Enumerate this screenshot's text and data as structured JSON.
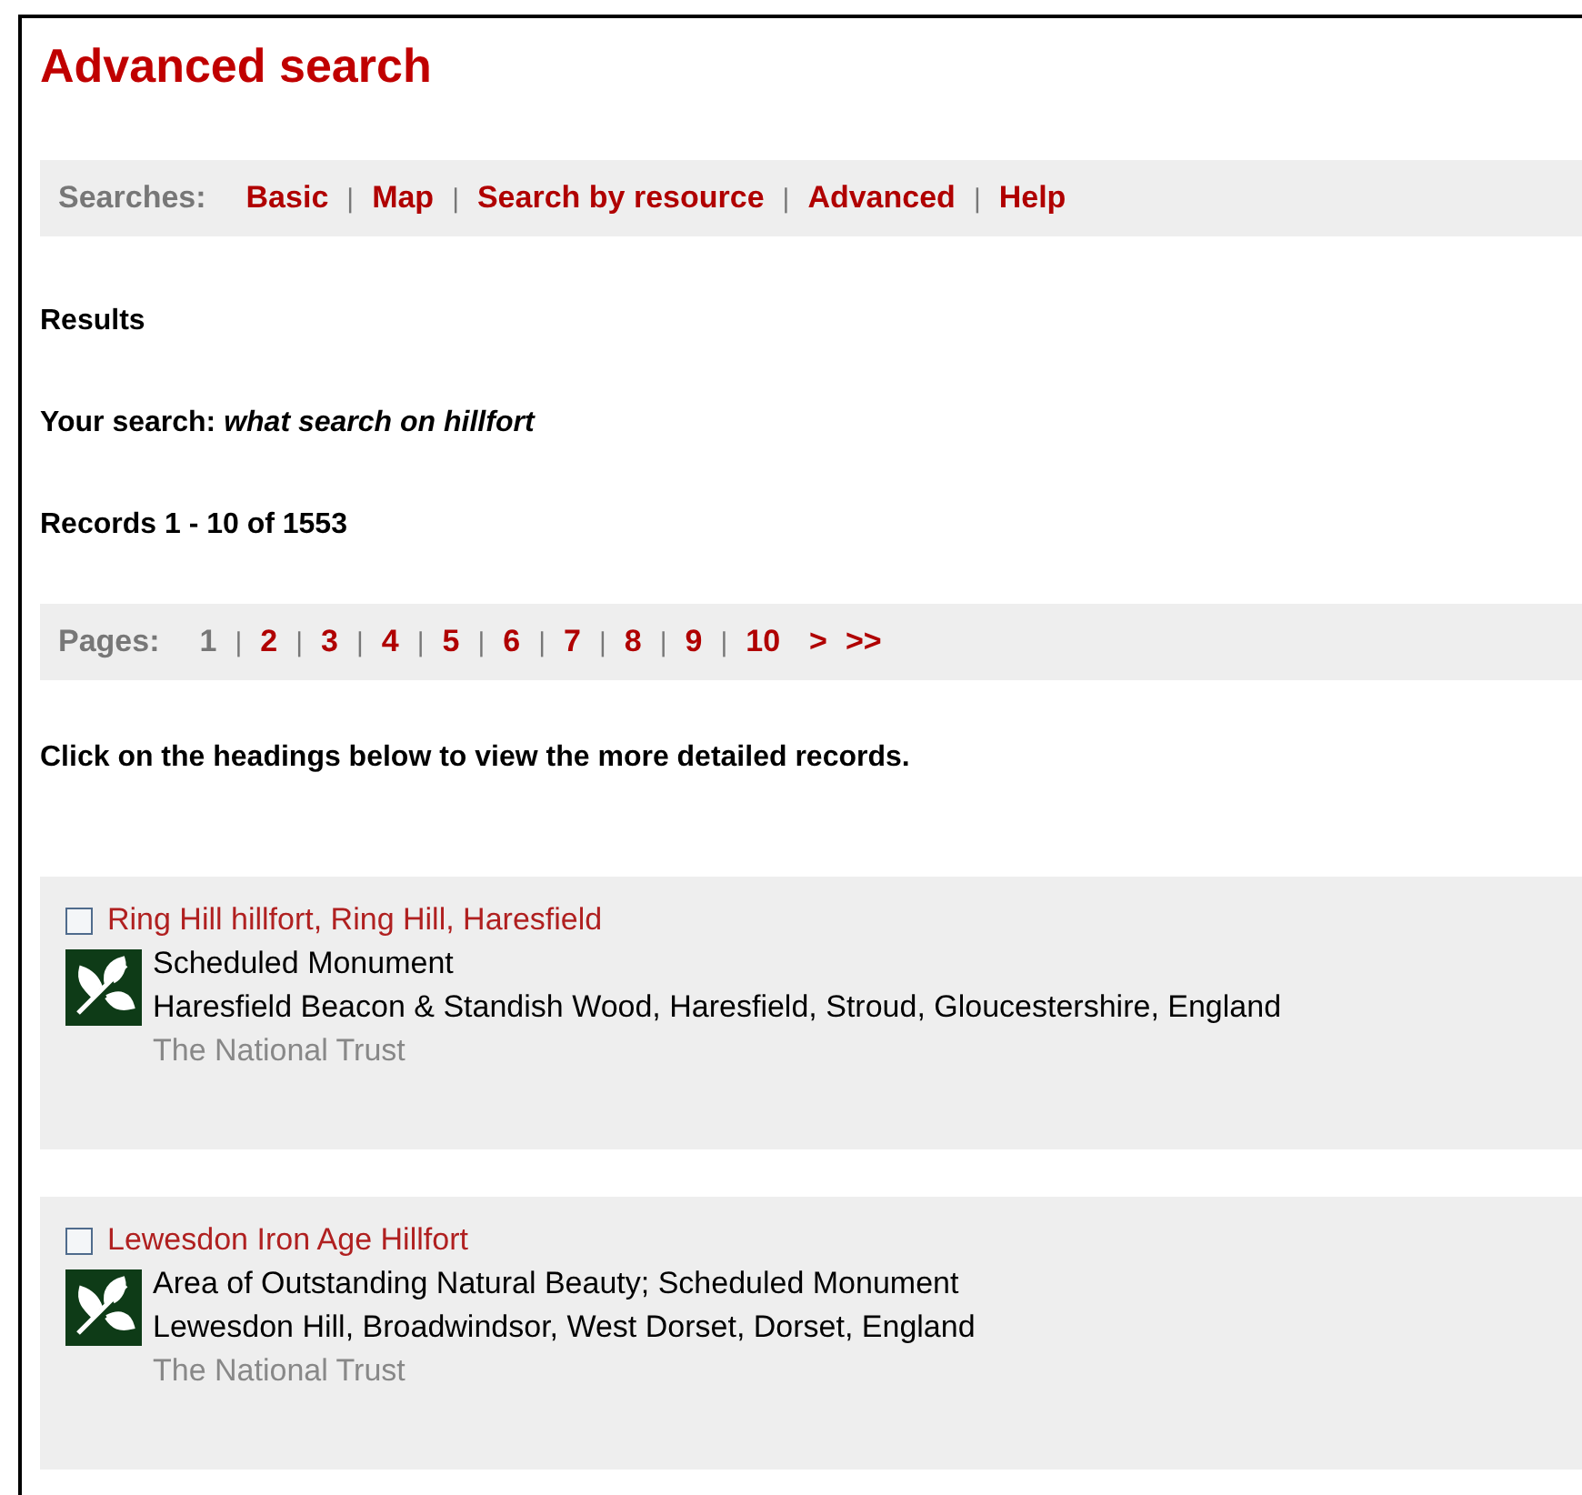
{
  "title": "Advanced search",
  "searches": {
    "label": "Searches:",
    "separator": "|",
    "links": [
      {
        "label": "Basic"
      },
      {
        "label": "Map"
      },
      {
        "label": "Search by resource"
      },
      {
        "label": "Advanced"
      },
      {
        "label": "Help"
      }
    ]
  },
  "results_heading": "Results",
  "your_search": {
    "label": "Your search:",
    "query": "what search on hillfort"
  },
  "records_count": "Records 1 - 10 of 1553",
  "pages": {
    "label": "Pages:",
    "separator": "|",
    "items": [
      {
        "label": "1",
        "selected": true
      },
      {
        "label": "2",
        "selected": false
      },
      {
        "label": "3",
        "selected": false
      },
      {
        "label": "4",
        "selected": false
      },
      {
        "label": "5",
        "selected": false
      },
      {
        "label": "6",
        "selected": false
      },
      {
        "label": "7",
        "selected": false
      },
      {
        "label": "8",
        "selected": false
      },
      {
        "label": "9",
        "selected": false
      },
      {
        "label": "10",
        "selected": false
      }
    ],
    "next": ">",
    "last": ">>"
  },
  "instruction": "Click on the headings below to view the more detailed records.",
  "records": [
    {
      "title": "Ring Hill hillfort, Ring Hill, Haresfield",
      "checked": false,
      "designation": "Scheduled Monument",
      "location": "Haresfield Beacon & Standish Wood, Haresfield, Stroud, Gloucestershire, England",
      "owner": "The National Trust"
    },
    {
      "title": "Lewesdon Iron Age Hillfort",
      "checked": false,
      "designation": "Area of Outstanding Natural Beauty; Scheduled Monument",
      "location": "Lewesdon Hill, Broadwindsor, West Dorset, Dorset, England",
      "owner": "The National Trust"
    }
  ]
}
